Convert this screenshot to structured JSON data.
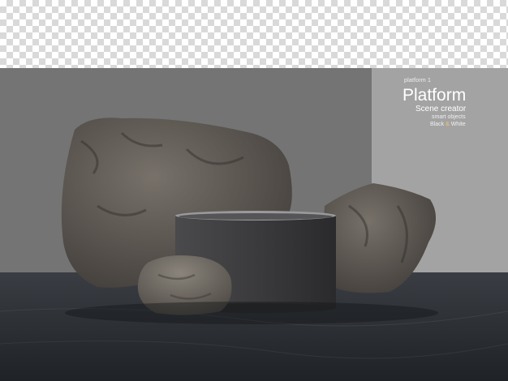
{
  "colors": {
    "wall": "#747474",
    "side_wall": "#a3a3a3",
    "floor": "#2c2f35",
    "rock": "#5a5650",
    "podium": "#3c3c3e",
    "accent": "#f3c56a"
  },
  "label": {
    "caption": "platform 1",
    "title": "Platform",
    "subtitle": "Scene creator",
    "line1": "smart objects",
    "line2_a": "Black",
    "line2_amp": "&",
    "line2_b": "White"
  }
}
